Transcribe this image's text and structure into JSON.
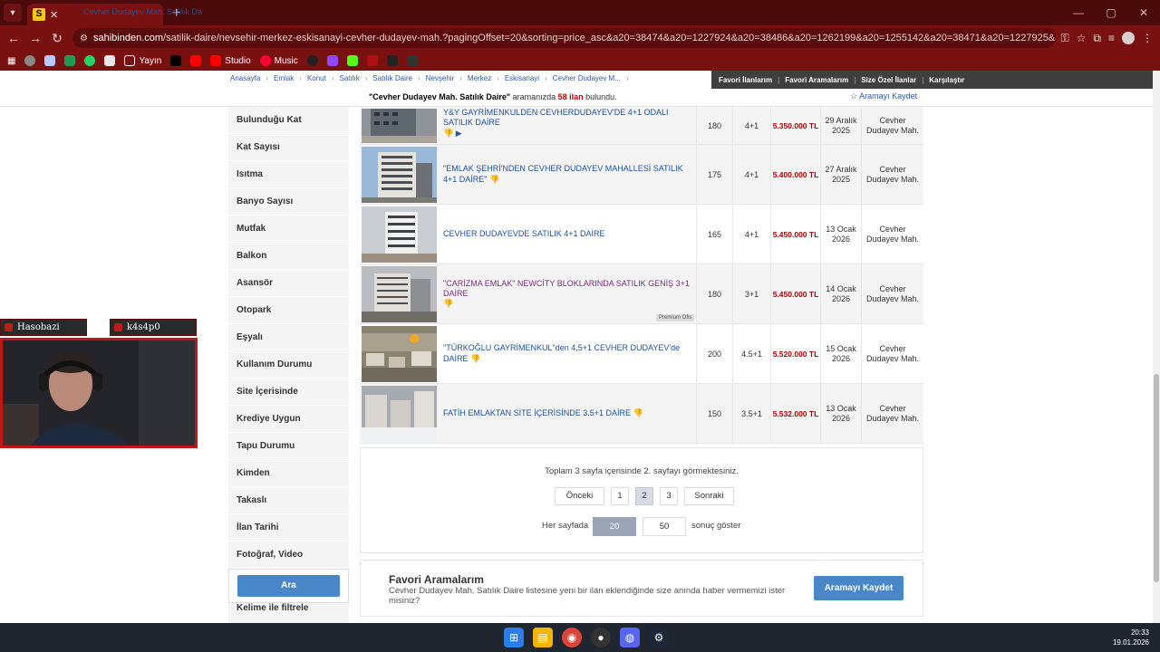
{
  "browser": {
    "tab_title": "Cevher Dudayev Mah. Satılık Da",
    "tab_favicon": "S",
    "url_host": "sahibinden.com",
    "url_path": "/satilik-daire/nevsehir-merkez-eskisanayi-cevher-dudayev-mah.?pagingOffset=20&sorting=price_asc&a20=38474&a20=1227924&a20=38486&a20=1262199&a20=1255142&a20=38471&a20=1227925&a20=1269036&a20=38..."
  },
  "bookmarks": [
    "Yayın",
    "Studio",
    "Music"
  ],
  "breadcrumbs": [
    "Anasayfa",
    "Emlak",
    "Konut",
    "Satılık",
    "Satılık Daire",
    "Nevşehir",
    "Merkez",
    "Eskisanayi",
    "Cevher Dudayev M..."
  ],
  "user_menu": [
    "Favori İlanlarım",
    "Favori Aramalarım",
    "Size Özel İlanlar",
    "Karşılaştır"
  ],
  "result": {
    "query": "\"Cevher Dudayev Mah. Satılık Daire\"",
    "middle": " aramanızda ",
    "count": "58 ilan",
    "tail": " bulundu.",
    "save_search": "Aramayı Kaydet"
  },
  "filters": [
    "Bulunduğu Kat",
    "Kat Sayısı",
    "Isıtma",
    "Banyo Sayısı",
    "Mutfak",
    "Balkon",
    "Asansör",
    "Otopark",
    "Eşyalı",
    "Kullanım Durumu",
    "Site İçerisinde",
    "Krediye Uygun",
    "Tapu Durumu",
    "Kimden",
    "Takaslı",
    "İlan Tarihi",
    "Fotoğraf, Video"
  ],
  "search_button": "Ara",
  "keyword_filter": "Kelime ile filtrele",
  "listings": [
    {
      "title": "Y&Y GAYRİMENKULDEN CEVHERDUDAYEV'DE 4+1 ODALI SATILIK DAİRE",
      "m2": "180",
      "rooms": "4+1",
      "price": "5.350.000 TL",
      "date1": "29 Aralık",
      "date2": "2025",
      "loc1": "Cevher",
      "loc2": "Dudayev Mah."
    },
    {
      "title": "\"EMLAK ŞEHRİ'NDEN CEVHER DUDAYEV MAHALLESİ SATILIK 4+1 DAİRE\"",
      "m2": "175",
      "rooms": "4+1",
      "price": "5.400.000 TL",
      "date1": "27 Aralık",
      "date2": "2025",
      "loc1": "Cevher",
      "loc2": "Dudayev Mah."
    },
    {
      "title": "CEVHER DUDAYEVDE SATILIK 4+1 DAİRE",
      "m2": "165",
      "rooms": "4+1",
      "price": "5.450.000 TL",
      "date1": "13 Ocak",
      "date2": "2026",
      "loc1": "Cevher",
      "loc2": "Dudayev Mah."
    },
    {
      "title": "\"CARİZMA EMLAK\" NEWCİTY BLOKLARINDA SATILIK GENİŞ 3+1 DAİRE",
      "m2": "180",
      "rooms": "3+1",
      "price": "5.450.000 TL",
      "date1": "14 Ocak",
      "date2": "2026",
      "loc1": "Cevher",
      "loc2": "Dudayev Mah.",
      "badge": "Premium Ofis"
    },
    {
      "title": "\"TÜRKOĞLU GAYRİMENKUL\"den 4,5+1 CEVHER DUDAYEV'de DAİRE",
      "m2": "200",
      "rooms": "4.5+1",
      "price": "5.520.000 TL",
      "date1": "15 Ocak",
      "date2": "2026",
      "loc1": "Cevher",
      "loc2": "Dudayev Mah."
    },
    {
      "title": "FATİH EMLAKTAN SİTE İÇERİSİNDE 3.5+1 DAİRE",
      "m2": "150",
      "rooms": "3.5+1",
      "price": "5.532.000 TL",
      "date1": "13 Ocak",
      "date2": "2026",
      "loc1": "Cevher",
      "loc2": "Dudayev Mah."
    }
  ],
  "pagination": {
    "info": "Toplam 3 sayfa içerisinde 2. sayfayı görmektesiniz.",
    "prev": "Önceki",
    "pages": [
      "1",
      "2",
      "3"
    ],
    "current": "2",
    "next": "Sonraki",
    "per_page_label": "Her sayfada",
    "per_page_options": [
      "20",
      "50"
    ],
    "per_page_selected": "20",
    "per_page_suffix": "sonuç göster"
  },
  "promo": {
    "title": "Favori Aramalarım",
    "text": "Cevher Dudayev Mah. Satılık Daire listesine yeni bir ilan eklendiğinde size anında haber vermemizi ister misiniz?",
    "button": "Aramayı Kaydet"
  },
  "webcam": {
    "tag1": "Hasobazi",
    "tag2": "k4s4p0"
  },
  "taskbar": {
    "time": "20:33",
    "date": "19.01.2026"
  },
  "colors": {
    "browser_frame": "#7a1111",
    "accent_button": "#4a87c9",
    "price": "#aa0000"
  }
}
